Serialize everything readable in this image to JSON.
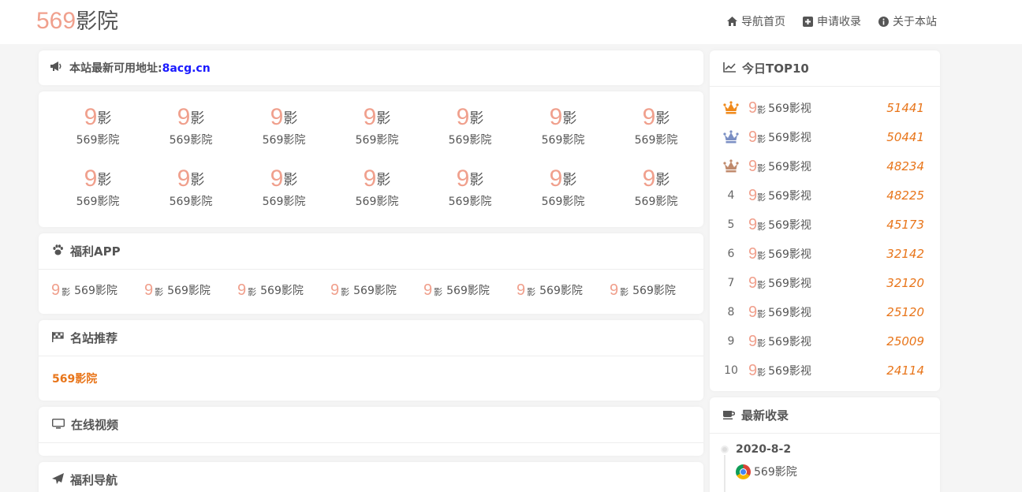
{
  "header": {
    "logo_num": "569",
    "logo_text": "影院",
    "nav": [
      {
        "label": "导航首页",
        "icon": "home-icon"
      },
      {
        "label": "申请收录",
        "icon": "plus-square-icon"
      },
      {
        "label": "关于本站",
        "icon": "info-circle-icon"
      }
    ]
  },
  "notice": {
    "text": "本站最新可用地址:",
    "address": "8acg.cn",
    "icon": "megaphone-icon"
  },
  "grid": {
    "logo_num": "9",
    "logo_char": "影",
    "items": [
      "569影院",
      "569影院",
      "569影院",
      "569影院",
      "569影院",
      "569影院",
      "569影院",
      "569影院",
      "569影院",
      "569影院",
      "569影院",
      "569影院",
      "569影院",
      "569影院"
    ]
  },
  "app_section": {
    "title": "福利APP",
    "icon": "paw-icon",
    "items": [
      "569影院",
      "569影院",
      "569影院",
      "569影院",
      "569影院",
      "569影院",
      "569影院"
    ]
  },
  "recommend_section": {
    "title": "名站推荐",
    "icon": "flag-checkered-icon",
    "link": "569影院"
  },
  "video_section": {
    "title": "在线视频",
    "icon": "monitor-icon"
  },
  "welfare_nav_section": {
    "title": "福利导航",
    "icon": "paper-plane-icon"
  },
  "top10": {
    "title": "今日TOP10",
    "icon": "line-chart-icon",
    "rows": [
      {
        "rank": "1",
        "name": "569影视",
        "count": "51441",
        "crown": "#f08a1c"
      },
      {
        "rank": "2",
        "name": "569影视",
        "count": "50441",
        "crown": "#7b8fc4"
      },
      {
        "rank": "3",
        "name": "569影视",
        "count": "48234",
        "crown": "#c08a6c"
      },
      {
        "rank": "4",
        "name": "569影视",
        "count": "48225"
      },
      {
        "rank": "5",
        "name": "569影视",
        "count": "45173"
      },
      {
        "rank": "6",
        "name": "569影视",
        "count": "32142"
      },
      {
        "rank": "7",
        "name": "569影视",
        "count": "32120"
      },
      {
        "rank": "8",
        "name": "569影视",
        "count": "25120"
      },
      {
        "rank": "9",
        "name": "569影视",
        "count": "25009"
      },
      {
        "rank": "10",
        "name": "569影视",
        "count": "24114"
      }
    ]
  },
  "latest": {
    "title": "最新收录",
    "icon": "coffee-icon",
    "date": "2020-8-2",
    "item": "569影院",
    "item_icon": "chrome-icon"
  },
  "colors": {
    "accent_orange": "#e8751a",
    "logo_pink": "#f0a08d",
    "link_blue": "#1a1aff"
  }
}
